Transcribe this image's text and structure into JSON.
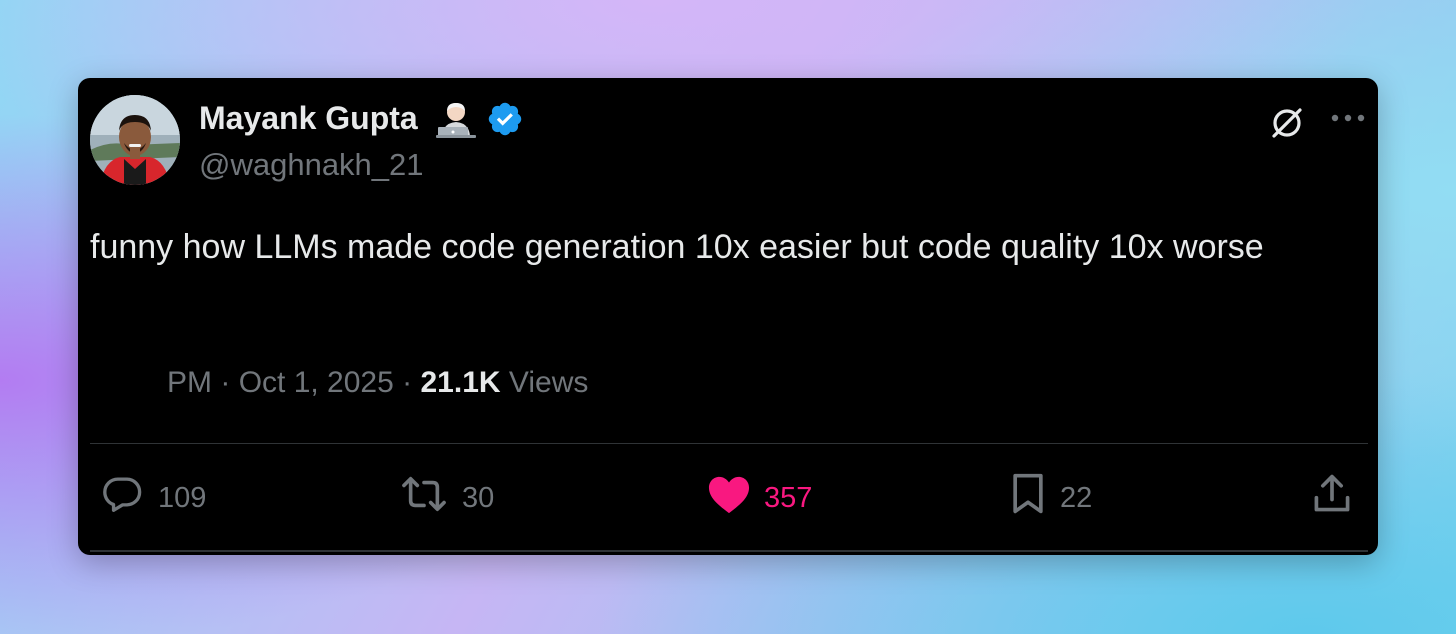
{
  "tweet": {
    "author": {
      "display_name": "Mayank Gupta",
      "name_emoji": "technologist-emoji",
      "handle": "@waghnakh_21",
      "verified": true,
      "verified_color": "#1d9bf0"
    },
    "text": "funny how LLMs made code generation 10x easier but code quality 10x worse",
    "meta": {
      "time": "PM",
      "separator": "·",
      "date": "Oct 1, 2025",
      "views_count": "21.1K",
      "views_label": "Views"
    },
    "actions": {
      "replies": {
        "icon": "reply-icon",
        "count": "109"
      },
      "reposts": {
        "icon": "repost-icon",
        "count": "30"
      },
      "likes": {
        "icon": "heart-icon",
        "count": "357",
        "color": "#f91880"
      },
      "bookmarks": {
        "icon": "bookmark-icon",
        "count": "22"
      },
      "share": {
        "icon": "share-icon"
      }
    },
    "header_icons": [
      "grok-icon",
      "more-icon"
    ]
  }
}
